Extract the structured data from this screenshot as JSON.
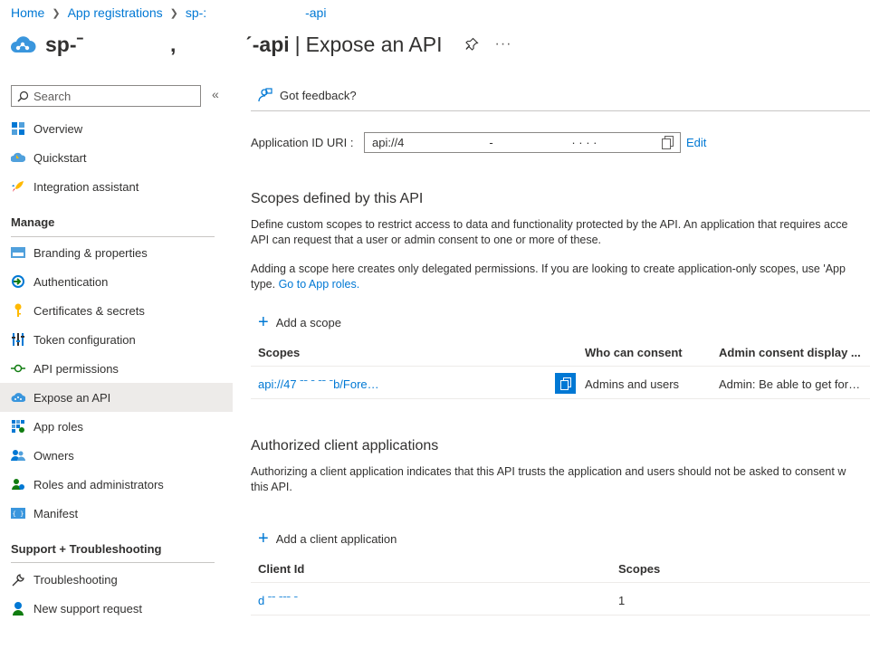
{
  "breadcrumb": {
    "home": "Home",
    "app_registrations": "App registrations",
    "current": "sp-:                            -api"
  },
  "header": {
    "resource_name": "sp-ˉ               ,            ˊ-api",
    "separator": "|",
    "page_title": "Expose an API",
    "pin_icon": "pin-icon",
    "more": "···"
  },
  "sidebar": {
    "search_placeholder": "Search",
    "collapse": "«",
    "top_items": [
      {
        "label": "Overview",
        "icon": "overview-icon"
      },
      {
        "label": "Quickstart",
        "icon": "quickstart-icon"
      },
      {
        "label": "Integration assistant",
        "icon": "rocket-icon"
      }
    ],
    "manage_heading": "Manage",
    "manage_items": [
      {
        "label": "Branding & properties",
        "icon": "branding-icon"
      },
      {
        "label": "Authentication",
        "icon": "authentication-icon"
      },
      {
        "label": "Certificates & secrets",
        "icon": "key-icon"
      },
      {
        "label": "Token configuration",
        "icon": "token-icon"
      },
      {
        "label": "API permissions",
        "icon": "api-permissions-icon"
      },
      {
        "label": "Expose an API",
        "icon": "cloud-icon",
        "active": true
      },
      {
        "label": "App roles",
        "icon": "app-roles-icon"
      },
      {
        "label": "Owners",
        "icon": "owners-icon"
      },
      {
        "label": "Roles and administrators",
        "icon": "roles-icon"
      },
      {
        "label": "Manifest",
        "icon": "manifest-icon"
      }
    ],
    "support_heading": "Support + Troubleshooting",
    "support_items": [
      {
        "label": "Troubleshooting",
        "icon": "wrench-icon"
      },
      {
        "label": "New support request",
        "icon": "support-person-icon"
      }
    ]
  },
  "toolbar": {
    "feedback_label": "Got feedback?"
  },
  "app_id_uri": {
    "label": "Application ID URI :",
    "value": "api://4                          -                        · · · · ",
    "edit": "Edit"
  },
  "scopes": {
    "heading": "Scopes defined by this API",
    "desc_line1": "Define custom scopes to restrict access to data and functionality protected by the API. An application that requires acce",
    "desc_line2": "API can request that a user or admin consent to one or more of these.",
    "note_line1": "Adding a scope here creates only delegated permissions. If you are looking to create application-only scopes, use 'App",
    "note_prefix": "type. ",
    "note_link": "Go to App roles.",
    "add_label": "Add a scope",
    "columns": [
      "Scopes",
      "Who can consent",
      "Admin consent display ..."
    ],
    "rows": [
      {
        "scope": "api://47 ˉˉ                                        ˉ ˉˉ ˉb/Fore…",
        "who": "Admins and users",
        "admin_display": "Admin: Be able to get for…"
      }
    ]
  },
  "clients": {
    "heading": "Authorized client applications",
    "desc_line1": "Authorizing a client application indicates that this API trusts the application and users should not be asked to consent w",
    "desc_line2": "this API.",
    "add_label": "Add a client application",
    "columns": [
      "Client Id",
      "Scopes"
    ],
    "rows": [
      {
        "client_id": "d ˉˉ ˉˉˉ                                          ˉ",
        "scopes": "1"
      }
    ]
  },
  "colors": {
    "accent": "#0078d4",
    "active_bg": "#edebe9",
    "text": "#323130",
    "border": "#8a8886"
  }
}
